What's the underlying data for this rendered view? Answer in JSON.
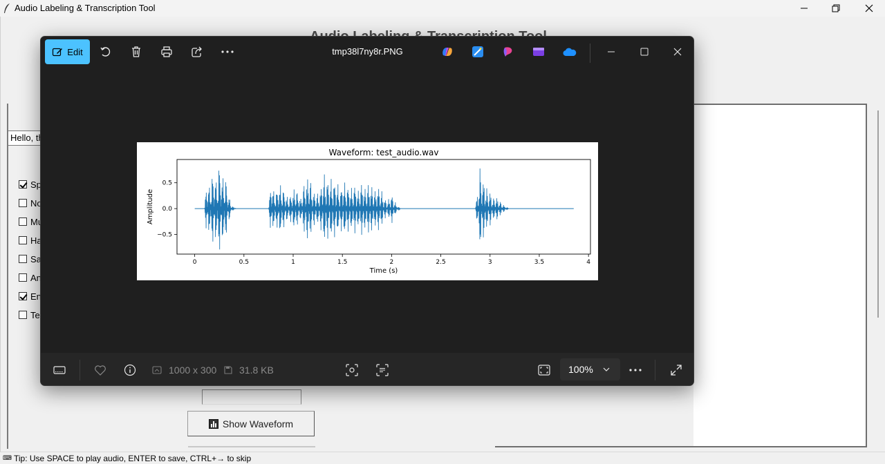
{
  "app": {
    "title": "Audio Labeling & Transcription Tool",
    "heading": "Audio Labeling & Transcription Tool",
    "text_entry_value": "Hello, th",
    "checkboxes": [
      {
        "label": "Sp",
        "checked": true
      },
      {
        "label": "No",
        "checked": false
      },
      {
        "label": "Mu",
        "checked": false
      },
      {
        "label": "Ha",
        "checked": false
      },
      {
        "label": "Sa",
        "checked": false
      },
      {
        "label": "An",
        "checked": false
      },
      {
        "label": "En",
        "checked": true
      },
      {
        "label": "Te",
        "checked": false
      }
    ],
    "show_waveform_label": "Show Waveform",
    "status_tip": "Tip: Use SPACE to play audio, ENTER to save, CTRL+→ to skip"
  },
  "viewer": {
    "edit_label": "Edit",
    "file_name": "tmp38l7ny8r.PNG",
    "dimensions": "1000 x 300",
    "file_size": "31.8 KB",
    "zoom": "100%",
    "icons": {
      "toolbar": [
        "rotate-icon",
        "delete-icon",
        "print-icon",
        "share-icon",
        "more-icon"
      ],
      "apps": [
        "copilot-icon",
        "designer-icon",
        "paint-icon",
        "clipchamp-icon",
        "onedrive-icon"
      ],
      "bottom": [
        "filmstrip-icon",
        "favorite-icon",
        "info-icon",
        "visual-search-icon",
        "text-scan-icon",
        "fit-screen-icon",
        "more-icon",
        "fullscreen-icon"
      ]
    },
    "accent_color": "#4cc2ff"
  },
  "chart_data": {
    "type": "line",
    "title": "Waveform: test_audio.wav",
    "xlabel": "Time (s)",
    "ylabel": "Amplitude",
    "xlim": [
      -0.18,
      4.02
    ],
    "ylim": [
      -0.88,
      0.95
    ],
    "xticks": [
      0,
      0.5,
      1,
      1.5,
      2,
      2.5,
      3,
      3.5,
      4
    ],
    "yticks": [
      -0.5,
      0.0,
      0.5
    ],
    "grid": false,
    "series_color": "#1f77b4",
    "envelope": {
      "x": [
        0.0,
        0.1,
        0.12,
        0.15,
        0.18,
        0.2,
        0.22,
        0.24,
        0.26,
        0.28,
        0.3,
        0.32,
        0.34,
        0.38,
        0.42,
        0.48,
        0.55,
        0.75,
        0.78,
        0.8,
        0.83,
        0.86,
        0.9,
        0.95,
        1.0,
        1.02,
        1.05,
        1.08,
        1.1,
        1.13,
        1.16,
        1.2,
        1.25,
        1.28,
        1.3,
        1.33,
        1.36,
        1.4,
        1.45,
        1.48,
        1.5,
        1.53,
        1.56,
        1.6,
        1.63,
        1.66,
        1.7,
        1.73,
        1.76,
        1.8,
        1.83,
        1.86,
        1.9,
        1.93,
        1.96,
        2.0,
        2.03,
        2.06,
        2.1,
        2.15,
        2.2,
        2.85,
        2.88,
        2.9,
        2.92,
        2.95,
        2.98,
        3.0,
        3.03,
        3.06,
        3.1,
        3.15,
        3.2,
        3.85
      ],
      "amplitude": [
        0.0,
        0.0,
        0.55,
        0.45,
        0.7,
        0.75,
        0.55,
        0.85,
        0.9,
        0.6,
        0.75,
        0.55,
        0.3,
        0.05,
        0.0,
        0.0,
        0.0,
        0.0,
        0.65,
        0.35,
        0.35,
        0.5,
        0.4,
        0.2,
        0.35,
        0.45,
        0.3,
        0.2,
        0.45,
        0.55,
        0.7,
        0.35,
        0.3,
        0.4,
        0.65,
        0.7,
        0.55,
        0.6,
        0.5,
        0.35,
        0.55,
        0.5,
        0.45,
        0.4,
        0.5,
        0.35,
        0.55,
        0.4,
        0.5,
        0.45,
        0.35,
        0.45,
        0.35,
        0.2,
        0.15,
        0.3,
        0.15,
        0.05,
        0.0,
        0.0,
        0.0,
        0.0,
        0.45,
        0.85,
        0.6,
        0.55,
        0.3,
        0.35,
        0.2,
        0.25,
        0.15,
        0.05,
        0.0,
        0.0
      ]
    }
  }
}
